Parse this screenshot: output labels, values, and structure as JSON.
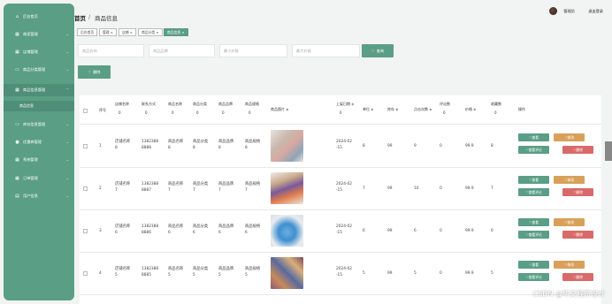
{
  "sidebar": {
    "items": [
      {
        "label": "后台首页",
        "icon": "home-icon"
      },
      {
        "label": "商家管理",
        "icon": "grid-icon"
      },
      {
        "label": "店铺管理",
        "icon": "grid-icon"
      },
      {
        "label": "商品分类管理",
        "icon": "monitor-icon"
      },
      {
        "label": "商品信息管理",
        "icon": "grid-icon"
      },
      {
        "label": "库存信息管理",
        "icon": "monitor-icon"
      },
      {
        "label": "优惠券管理",
        "icon": "user-icon"
      },
      {
        "label": "系统管理",
        "icon": "grid-icon"
      },
      {
        "label": "订单管理",
        "icon": "grid-icon"
      },
      {
        "label": "用户信息",
        "icon": "card-icon"
      }
    ],
    "sub_item": "商品信息"
  },
  "header": {
    "home": "首页",
    "separator": "/",
    "page": "商品信息",
    "user": "管理员",
    "logout": "退出登录"
  },
  "tabs": [
    "后台首页",
    "管理 ×",
    "店铺 ×",
    "商品分类 ×",
    "商品信息 ×"
  ],
  "search": {
    "name_placeholder": "商品名称",
    "brand_placeholder": "商品品牌",
    "min_price_placeholder": "最小价格",
    "max_price_placeholder": "最大价格",
    "search_label": "查询",
    "delete_label": "删除"
  },
  "table": {
    "headers": {
      "index": "序号",
      "shop_name": "店铺名称",
      "contact": "联系方式",
      "product_name": "商品名称",
      "category": "商品分类",
      "brand": "商品品牌",
      "spec": "商品规格",
      "image": "商品图片",
      "date": "上架日期",
      "unit": "单位",
      "stock": "库存",
      "clicks": "点击次数",
      "reviews": "评论数",
      "price": "价格",
      "favorites": "收藏数",
      "actions": "操作",
      "sort_mark": "◆",
      "zero": "0"
    },
    "rows": [
      {
        "index": "1",
        "shop_a": "店铺名称",
        "shop_b": "8",
        "contact_a": "1382388",
        "contact_b": "8888",
        "name_a": "商品名称",
        "name_b": "8",
        "cat_a": "商品分类",
        "cat_b": "8",
        "brand_a": "商品品牌",
        "brand_b": "8",
        "spec_a": "商品规格",
        "spec_b": "8",
        "date_a": "2024-02",
        "date_b": "-15",
        "unit": "8",
        "stock": "99",
        "clicks": "9",
        "reviews": "0",
        "price": "99.9",
        "fav": "8"
      },
      {
        "index": "2",
        "shop_a": "店铺名称",
        "shop_b": "7",
        "contact_a": "1382388",
        "contact_b": "8887",
        "name_a": "商品名称",
        "name_b": "7",
        "cat_a": "商品分类",
        "cat_b": "7",
        "brand_a": "商品品牌",
        "brand_b": "7",
        "spec_a": "商品规格",
        "spec_b": "7",
        "date_a": "2024-02",
        "date_b": "-15",
        "unit": "7",
        "stock": "99",
        "clicks": "10",
        "reviews": "0",
        "price": "99.9",
        "fav": "7"
      },
      {
        "index": "3",
        "shop_a": "店铺名称",
        "shop_b": "6",
        "contact_a": "1382388",
        "contact_b": "8886",
        "name_a": "商品名称",
        "name_b": "6",
        "cat_a": "商品分类",
        "cat_b": "6",
        "brand_a": "商品品牌",
        "brand_b": "6",
        "spec_a": "商品规格",
        "spec_b": "6",
        "date_a": "2024-02",
        "date_b": "-15",
        "unit": "6",
        "stock": "99",
        "clicks": "6",
        "reviews": "0",
        "price": "99.9",
        "fav": "6"
      },
      {
        "index": "4",
        "shop_a": "店铺名称",
        "shop_b": "5",
        "contact_a": "1382388",
        "contact_b": "8885",
        "name_a": "商品名称",
        "name_b": "5",
        "cat_a": "商品分类",
        "cat_b": "5",
        "brand_a": "商品品牌",
        "brand_b": "5",
        "spec_a": "商品规格",
        "spec_b": "5",
        "date_a": "2024-02",
        "date_b": "-15",
        "unit": "5",
        "stock": "99",
        "clicks": "5",
        "reviews": "0",
        "price": "99.9",
        "fav": "5"
      }
    ],
    "actions": {
      "view": "查看",
      "edit": "修改",
      "view_reviews": "查看评论",
      "delete": "删除"
    }
  },
  "watermark": "CSDN @毕文程序设计",
  "colors": {
    "accent": "#5a9e86",
    "edit": "#d9a05a",
    "delete": "#d86a6a"
  }
}
